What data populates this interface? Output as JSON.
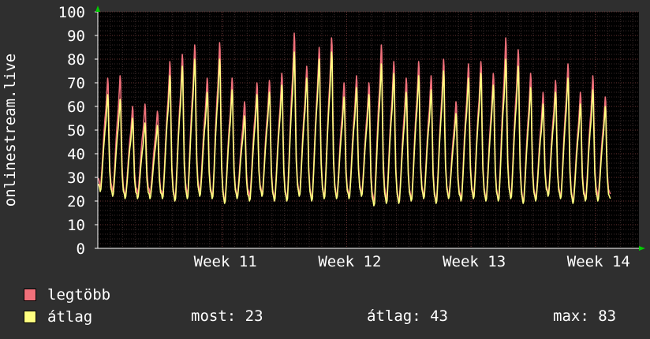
{
  "chart_data": {
    "type": "line",
    "ylabel": "onlinestream.live",
    "ylim": [
      0,
      100
    ],
    "y_ticks": [
      0,
      10,
      20,
      30,
      40,
      50,
      60,
      70,
      80,
      90,
      100
    ],
    "x_ticks": [
      {
        "label": "Week 11",
        "day": 10
      },
      {
        "label": "Week 12",
        "day": 20
      },
      {
        "label": "Week 13",
        "day": 30
      },
      {
        "label": "Week 14",
        "day": 40
      }
    ],
    "x_range_days": [
      0,
      43.5
    ],
    "grid": true,
    "series": [
      {
        "name": "legtöbb",
        "color": "#f0707a",
        "daily_peaks": [
          72,
          73,
          60,
          61,
          58,
          79,
          82,
          86,
          72,
          87,
          72,
          62,
          70,
          71,
          74,
          91,
          77,
          85,
          89,
          70,
          73,
          70,
          86,
          79,
          72,
          79,
          73,
          80,
          62,
          78,
          79,
          74,
          89,
          84,
          74,
          66,
          71,
          78,
          66,
          73,
          64
        ],
        "daily_mins": [
          26,
          24,
          22,
          23,
          23,
          22,
          21,
          23,
          24,
          22,
          20,
          22,
          22,
          23,
          21,
          21,
          23,
          21,
          22,
          22,
          22,
          23,
          20,
          21,
          20,
          21,
          22,
          20,
          22,
          21,
          22,
          21,
          21,
          22,
          20,
          21,
          23,
          22,
          20,
          21,
          22
        ]
      },
      {
        "name": "átlag",
        "color": "#ffff80",
        "daily_peaks": [
          65,
          63,
          55,
          53,
          52,
          73,
          77,
          80,
          66,
          80,
          67,
          56,
          65,
          66,
          69,
          83,
          72,
          80,
          83,
          64,
          68,
          65,
          78,
          74,
          66,
          73,
          67,
          75,
          57,
          72,
          74,
          69,
          80,
          77,
          68,
          61,
          66,
          72,
          61,
          67,
          60
        ],
        "daily_mins": [
          24,
          22,
          21,
          21,
          21,
          21,
          20,
          21,
          22,
          21,
          19,
          21,
          20,
          22,
          20,
          20,
          22,
          20,
          21,
          21,
          21,
          22,
          18,
          19,
          19,
          20,
          21,
          19,
          21,
          20,
          21,
          20,
          20,
          21,
          19,
          20,
          22,
          21,
          19,
          20,
          20
        ]
      }
    ]
  },
  "legend": {
    "max_label": "legtöbb",
    "avg_label": "átlag"
  },
  "stats": {
    "now": "most: 23",
    "avg": "átlag: 43",
    "max": "max: 83"
  }
}
